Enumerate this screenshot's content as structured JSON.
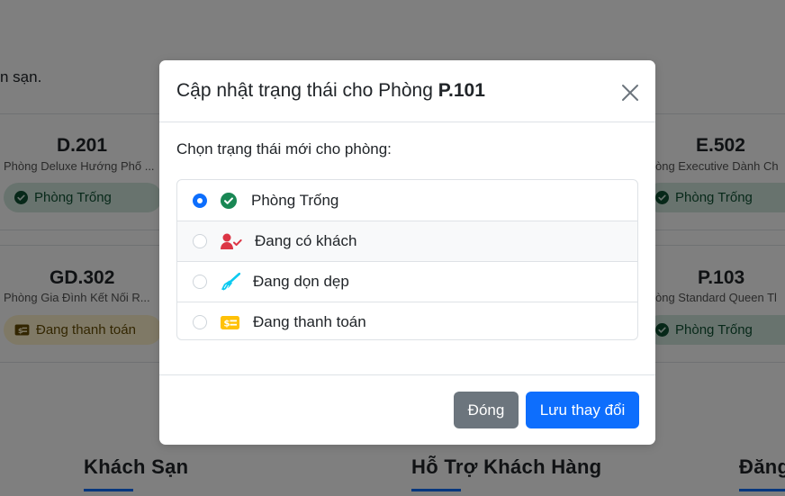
{
  "background": {
    "intro_text": "n sạn.",
    "cards": [
      {
        "code": "D.201",
        "desc": "Phòng Deluxe Hướng Phố ...",
        "status": "Phòng Trống"
      },
      {
        "code": "E.502",
        "desc": "òng Executive Dành Ch",
        "status": "Phòng Trống"
      },
      {
        "code": "GD.302",
        "desc": "Phòng Gia Đình Kết Nối R...",
        "status": "Đang thanh toán"
      },
      {
        "code": "P.103",
        "desc": "òng Standard Queen Tl",
        "status": "Phòng Trống"
      }
    ],
    "footer": [
      "Khách Sạn",
      "Hỗ Trợ Khách Hàng",
      "Đăng"
    ]
  },
  "modal": {
    "title_prefix": "Cập nhật trạng thái cho Phòng ",
    "room": "P.101",
    "prompt": "Chọn trạng thái mới cho phòng:",
    "options": [
      {
        "label": "Phòng Trống",
        "icon": "check-circle-icon",
        "color": "#198754",
        "selected": true
      },
      {
        "label": "Đang có khách",
        "icon": "person-check-icon",
        "color": "#dc3545",
        "selected": false
      },
      {
        "label": "Đang dọn dẹp",
        "icon": "broom-icon",
        "color": "#0dcaf0",
        "selected": false
      },
      {
        "label": "Đang thanh toán",
        "icon": "cash-card-icon",
        "color": "#ffc107",
        "selected": false
      }
    ],
    "close_label": "Đóng",
    "save_label": "Lưu thay đổi"
  },
  "colors": {
    "primary": "#0d6efd",
    "secondary": "#6c757d",
    "success": "#198754"
  }
}
